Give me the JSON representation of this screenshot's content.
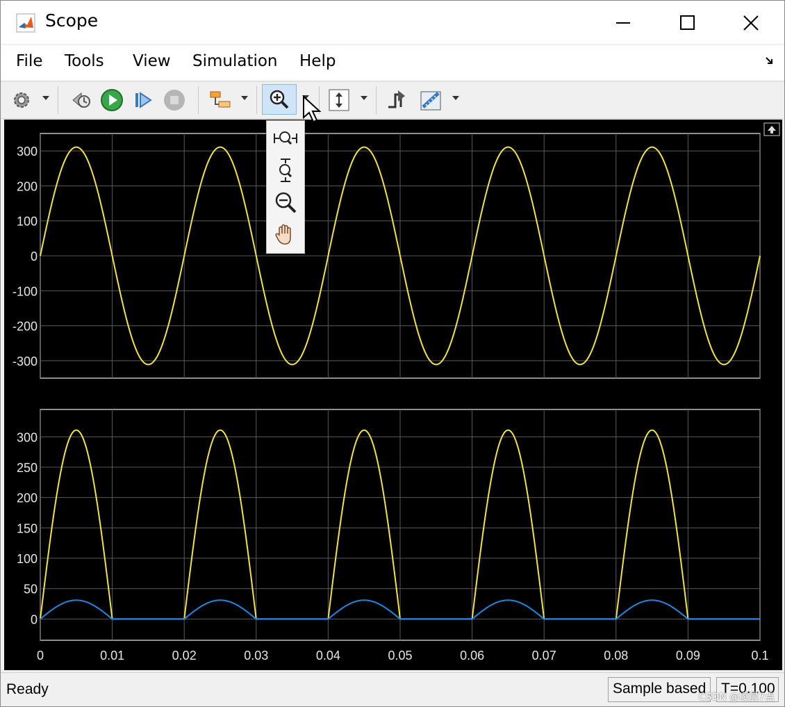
{
  "window": {
    "title": "Scope",
    "minimize_label": "—",
    "maximize_label": "☐",
    "close_label": "✕"
  },
  "menu": {
    "items": [
      "File",
      "Tools",
      "View",
      "Simulation",
      "Help"
    ]
  },
  "toolbar": {
    "icons": [
      "gear-icon",
      "step-back-icon",
      "run-icon",
      "step-forward-icon",
      "stop-icon",
      "signal-routing-icon",
      "zoom-in-icon",
      "scale-axes-icon",
      "triggers-icon",
      "measurements-icon"
    ]
  },
  "zoom_menu": {
    "items": [
      "zoom-x-icon",
      "zoom-y-icon",
      "zoom-out-icon",
      "pan-hand-icon"
    ]
  },
  "status": {
    "text": "Ready",
    "mode": "Sample based",
    "time": "T=0.100",
    "watermark": "CSDN @凌晨7点"
  },
  "colors": {
    "plot_bg": "#000000",
    "grid": "#5a5a5a",
    "axis_text": "#e6e6e6",
    "yellow": "#f2e33d",
    "blue": "#1e88e5"
  },
  "chart_data": [
    {
      "type": "line",
      "x_range": [
        0,
        0.1
      ],
      "ylim": [
        -350,
        350
      ],
      "y_ticks": [
        -300,
        -200,
        -100,
        0,
        100,
        200,
        300
      ],
      "x_ticks": [
        0,
        0.01,
        0.02,
        0.03,
        0.04,
        0.05,
        0.06,
        0.07,
        0.08,
        0.09,
        0.1
      ],
      "x_tick_labels": [],
      "grid": true,
      "series": [
        {
          "color": "#f2e33d",
          "amplitude": 311,
          "frequency_hz": 50,
          "shape": "sine"
        }
      ]
    },
    {
      "type": "line",
      "x_range": [
        0,
        0.1
      ],
      "ylim": [
        -35,
        345
      ],
      "y_ticks": [
        0,
        50,
        100,
        150,
        200,
        250,
        300
      ],
      "x_ticks": [
        0,
        0.01,
        0.02,
        0.03,
        0.04,
        0.05,
        0.06,
        0.07,
        0.08,
        0.09,
        0.1
      ],
      "x_tick_labels": [
        "0",
        "0.01",
        "0.02",
        "0.03",
        "0.04",
        "0.05",
        "0.06",
        "0.07",
        "0.08",
        "0.09",
        "0.1"
      ],
      "grid": true,
      "series": [
        {
          "color": "#f2e33d",
          "amplitude": 311,
          "frequency_hz": 50,
          "shape": "half-wave-rectified-sine"
        },
        {
          "color": "#1e88e5",
          "amplitude": 31,
          "frequency_hz": 50,
          "shape": "half-wave-rectified-sine"
        }
      ]
    }
  ]
}
